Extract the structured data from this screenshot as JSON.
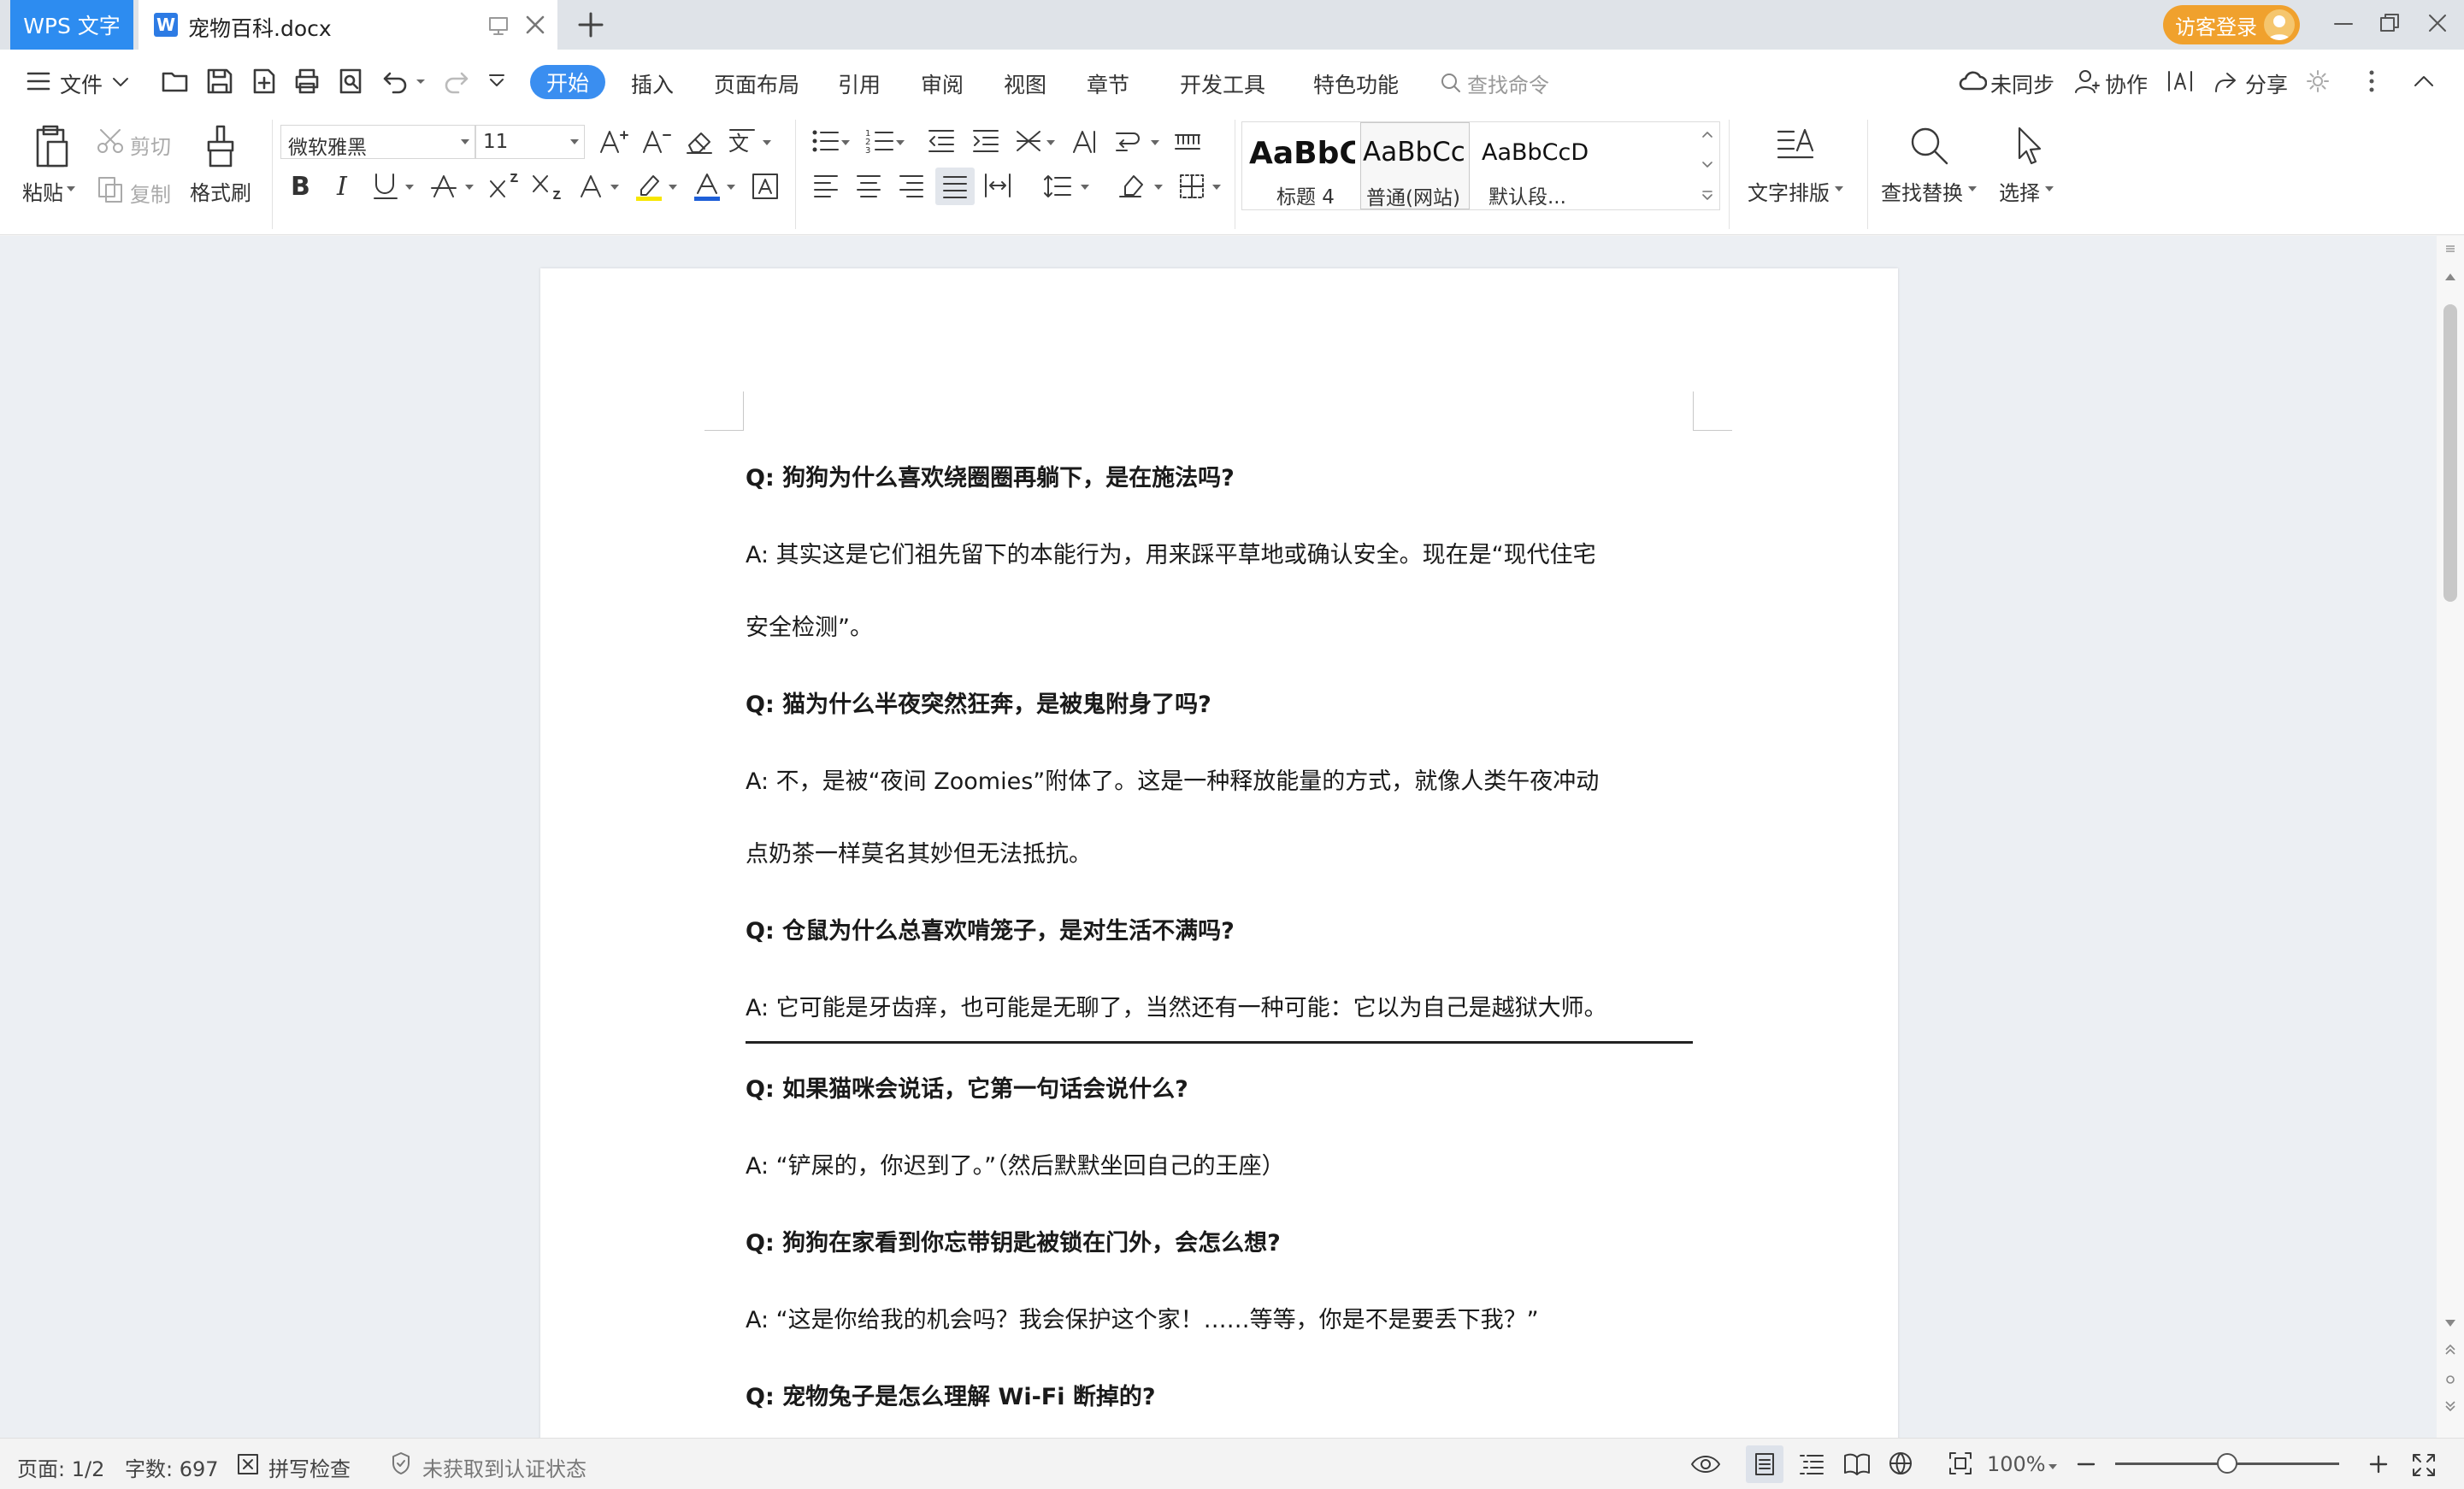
{
  "titlebar": {
    "app_tab": "WPS 文字",
    "doc_tab": "宠物百科.docx",
    "login": "访客登录"
  },
  "menu": {
    "file": "文件",
    "tabs": [
      "开始",
      "插入",
      "页面布局",
      "引用",
      "审阅",
      "视图",
      "章节",
      "开发工具",
      "特色功能"
    ],
    "search_placeholder": "查找命令",
    "sync": "未同步",
    "collab": "协作",
    "share": "分享"
  },
  "ribbon": {
    "paste": "粘贴",
    "cut": "剪切",
    "copy": "复制",
    "format_painter": "格式刷",
    "font_name": "微软雅黑",
    "font_size": "11",
    "styles": [
      {
        "sample": "AaBbC",
        "name": "标题 4"
      },
      {
        "sample": "AaBbCc",
        "name": "普通(网站)"
      },
      {
        "sample": "AaBbCcD",
        "name": "默认段..."
      }
    ],
    "text_layout": "文字排版",
    "find_replace": "查找替换",
    "select": "选择"
  },
  "document": {
    "items": [
      {
        "type": "q",
        "text": "Q:  狗狗为什么喜欢绕圈圈再躺下，是在施法吗?"
      },
      {
        "type": "a",
        "text": "A:  其实这是它们祖先留下的本能行为，用来踩平草地或确认安全。现在是“现代住宅"
      },
      {
        "type": "a",
        "text": "安全检测”。"
      },
      {
        "type": "q",
        "text": "Q:  猫为什么半夜突然狂奔，是被鬼附身了吗?"
      },
      {
        "type": "a",
        "text": "A:  不，是被“夜间 Zoomies”附体了。这是一种释放能量的方式，就像人类午夜冲动"
      },
      {
        "type": "a",
        "text": "点奶茶一样莫名其妙但无法抵抗。"
      },
      {
        "type": "q",
        "text": "Q:  仓鼠为什么总喜欢啃笼子，是对生活不满吗?"
      },
      {
        "type": "a",
        "text": "A:  它可能是牙齿痒，也可能是无聊了，当然还有一种可能：它以为自己是越狱大师。"
      },
      {
        "type": "q",
        "text": "Q:  如果猫咪会说话，它第一句话会说什么?"
      },
      {
        "type": "a",
        "text": "A:  “铲屎的，你迟到了。”（然后默默坐回自己的王座）"
      },
      {
        "type": "q",
        "text": "Q:  狗狗在家看到你忘带钥匙被锁在门外，会怎么想?"
      },
      {
        "type": "a",
        "text": "A:  “这是你给我的机会吗？我会保护这个家！……等等，你是不是要丢下我？”"
      },
      {
        "type": "q",
        "text": "Q:  宠物兔子是怎么理解 Wi-Fi 断掉的?"
      }
    ]
  },
  "status": {
    "page": "页面: 1/2",
    "words": "字数: 697",
    "spell": "拼写检查",
    "cert": "未获取到认证状态",
    "zoom": "100%",
    "zoom_level": 0.5
  }
}
